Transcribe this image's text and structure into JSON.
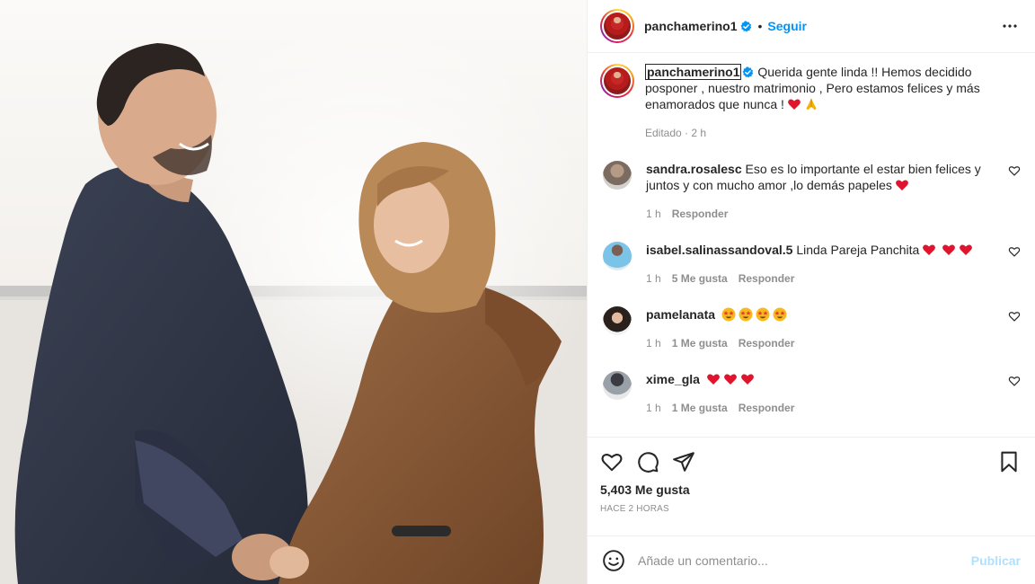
{
  "post": {
    "author": "panchamerino1",
    "follow_label": "Seguir",
    "more_icon": "more-horizontal-icon",
    "verified_color": "#0095f6"
  },
  "caption": {
    "user": "panchamerino1",
    "text": "Querida gente linda !! Hemos decidido posponer , nuestro matrimonio , Pero estamos felices y más enamorados que nunca !",
    "emojis": [
      "red-heart",
      "praying-hands"
    ],
    "meta": "Editado · 2 h"
  },
  "comments": [
    {
      "user": "sandra.rosalesc",
      "text": "Eso es lo importante el estar bien felices y juntos y con mucho amor ,lo demás papeles",
      "emojis": [
        "red-heart"
      ],
      "time": "1 h",
      "likes": "",
      "reply": "Responder"
    },
    {
      "user": "isabel.salinassandoval.5",
      "text": "Linda Pareja Panchita",
      "emojis": [
        "red-heart",
        "red-heart",
        "red-heart"
      ],
      "time": "1 h",
      "likes": "5 Me gusta",
      "reply": "Responder"
    },
    {
      "user": "pamelanata",
      "text": "",
      "emojis": [
        "star-struck",
        "star-struck",
        "star-struck",
        "star-struck"
      ],
      "time": "1 h",
      "likes": "1 Me gusta",
      "reply": "Responder"
    },
    {
      "user": "xime_gla",
      "text": "",
      "emojis": [
        "red-heart",
        "red-heart",
        "red-heart"
      ],
      "time": "1 h",
      "likes": "1 Me gusta",
      "reply": "Responder"
    }
  ],
  "actions": {
    "likes": "5,403 Me gusta",
    "time": "HACE 2 HORAS"
  },
  "add_comment": {
    "placeholder": "Añade un comentario...",
    "publish": "Publicar"
  },
  "colors": {
    "accent": "#0095f6",
    "publish_disabled": "#b2dffc",
    "muted": "#8e8e8e",
    "text": "#262626"
  }
}
